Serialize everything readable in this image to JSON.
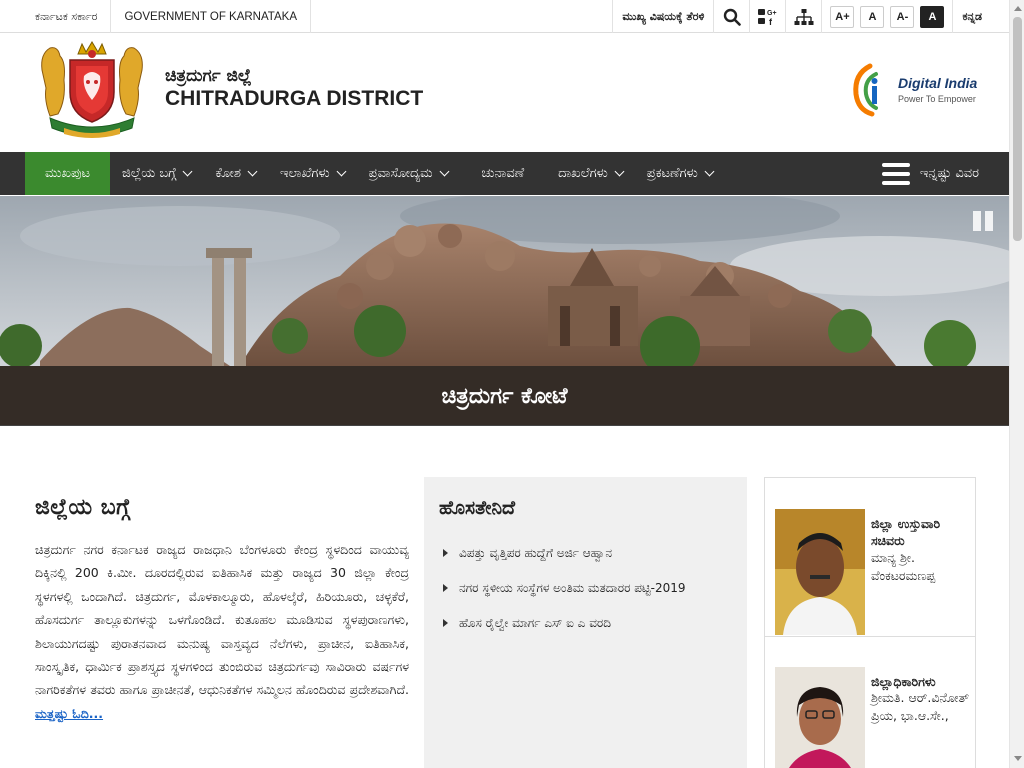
{
  "topbar": {
    "state_label": "ಕರ್ನಾಟಕ ಸರ್ಕಾರ",
    "government_label": "GOVERNMENT OF KARNATAKA",
    "skip_label": "ಮುಖ್ಯ ವಿಷಯಕ್ಕೆ ತೆರಳಿ",
    "font_increase": "A+",
    "font_normal": "A",
    "font_decrease": "A-",
    "high_contrast": "A",
    "language": "ಕನ್ನಡ"
  },
  "header": {
    "title_kn": "ಚಿತ್ರದುರ್ಗ ಜಿಲ್ಲೆ",
    "title_en": "CHITRADURGA DISTRICT",
    "digital_india": "Digital India",
    "digital_india_tagline": "Power To Empower"
  },
  "nav": {
    "items": [
      {
        "label": "ಮುಖಪುಟ",
        "active": true,
        "dropdown": false
      },
      {
        "label": "ಜಿಲ್ಲೆಯ ಬಗ್ಗೆ",
        "active": false,
        "dropdown": true
      },
      {
        "label": "ಕೋಶ",
        "active": false,
        "dropdown": true
      },
      {
        "label": "ಇಲಾಖೆಗಳು",
        "active": false,
        "dropdown": true
      },
      {
        "label": "ಪ್ರವಾಸೋದ್ಯಮ",
        "active": false,
        "dropdown": true
      },
      {
        "label": "ಚುನಾವಣೆ",
        "active": false,
        "dropdown": false
      },
      {
        "label": "ದಾಖಲೆಗಳು",
        "active": false,
        "dropdown": true
      },
      {
        "label": "ಪ್ರಕಟಣೆಗಳು",
        "active": false,
        "dropdown": true
      }
    ],
    "more_label": "ಇನ್ನಷ್ಟು ವಿವರ"
  },
  "banner": {
    "caption": "ಚಿತ್ರದುರ್ಗ ಕೋಟೆ"
  },
  "about": {
    "heading": "ಜಿಲ್ಲೆಯ ಬಗ್ಗೆ",
    "text": "ಚಿತ್ರದುರ್ಗ ನಗರ ಕರ್ನಾಟಕ ರಾಜ್ಯದ ರಾಜಧಾನಿ ಬೆಂಗಳೂರು ಕೇಂದ್ರ ಸ್ಥಳದಿಂದ ವಾಯುವ್ಯ ದಿಕ್ಕಿನಲ್ಲಿ 200 ಕಿ.ಮೀ. ದೂರದಲ್ಲಿರುವ ಐತಿಹಾಸಿಕ ಮತ್ತು ರಾಜ್ಯದ 30 ಜಿಲ್ಲಾ ಕೇಂದ್ರ ಸ್ಥಳಗಳಲ್ಲಿ ಒಂದಾಗಿದೆ. ಚಿತ್ರದುರ್ಗ, ಮೊಳಕಾಲ್ಮೂರು, ಹೊಳಲ್ಕೆರೆ, ಹಿರಿಯೂರು, ಚಳ್ಳಕೆರೆ, ಹೊಸದುರ್ಗ ತಾಲ್ಲೂಕುಗಳನ್ನು ಒಳಗೊಂಡಿದೆ. ಕುತೂಹಲ ಮೂಡಿಸುವ ಸ್ಥಳಪುರಾಣಗಳು, ಶಿಲಾಯುಗದಷ್ಟು ಪುರಾತನವಾದ ಮನುಷ್ಯ ವಾಸ್ತವ್ಯದ ನೆಲೆಗಳು, ಪ್ರಾಚೀನ, ಐತಿಹಾಸಿಕ, ಸಾಂಸ್ಕೃತಿಕ, ಧಾರ್ಮಿಕ ಪ್ರಾಶಸ್ತ್ಯದ ಸ್ಥಳಗಳಿಂದ ತುಂಬಿರುವ ಚಿತ್ರದುರ್ಗವು ಸಾವಿರಾರು ವರ್ಷಗಳ ನಾಗರಿಕತೆಗಳ ತವರು ಹಾಗೂ ಪ್ರಾಚೀನತೆ, ಆಧುನಿಕತೆಗಳ ಸಮ್ಮಿಲನ ಹೊಂದಿರುವ ಪ್ರದೇಶವಾಗಿದೆ.",
    "read_more": "ಮತ್ತಷ್ಟು ಓದಿ..."
  },
  "news": {
    "heading": "ಹೊಸತೇನಿದೆ",
    "items": [
      "ವಿಪತ್ತು ವೃತ್ತಿಪರ ಹುದ್ದೆಗೆ ಅರ್ಜಿ ಆಹ್ವಾನ",
      "ನಗರ ಸ್ಥಳೀಯ ಸಂಸ್ಥೆಗಳ ಅಂತಿಮ ಮತದಾರರ ಪಟ್ಟಿ-2019",
      "ಹೊಸ ರೈಲ್ವೇ ಮಾರ್ಗ ಎಸ್ ಐ ಎ ವರದಿ"
    ]
  },
  "officials": [
    {
      "role": "ಜಿಲ್ಲಾ ಉಸ್ತುವಾರಿ ಸಚಿವರು",
      "name": "ಮಾನ್ಯ ಶ್ರೀ. ವೆಂಕಟರಮಣಪ್ಪ"
    },
    {
      "role": "ಜಿಲ್ಲಾಧಿಕಾರಿಗಳು",
      "name": "ಶ್ರೀಮತಿ. ಆರ್.ವಿನೋತ್ ಪ್ರಿಯ, ಭಾ.ಆ.ಸೇ.,"
    }
  ]
}
